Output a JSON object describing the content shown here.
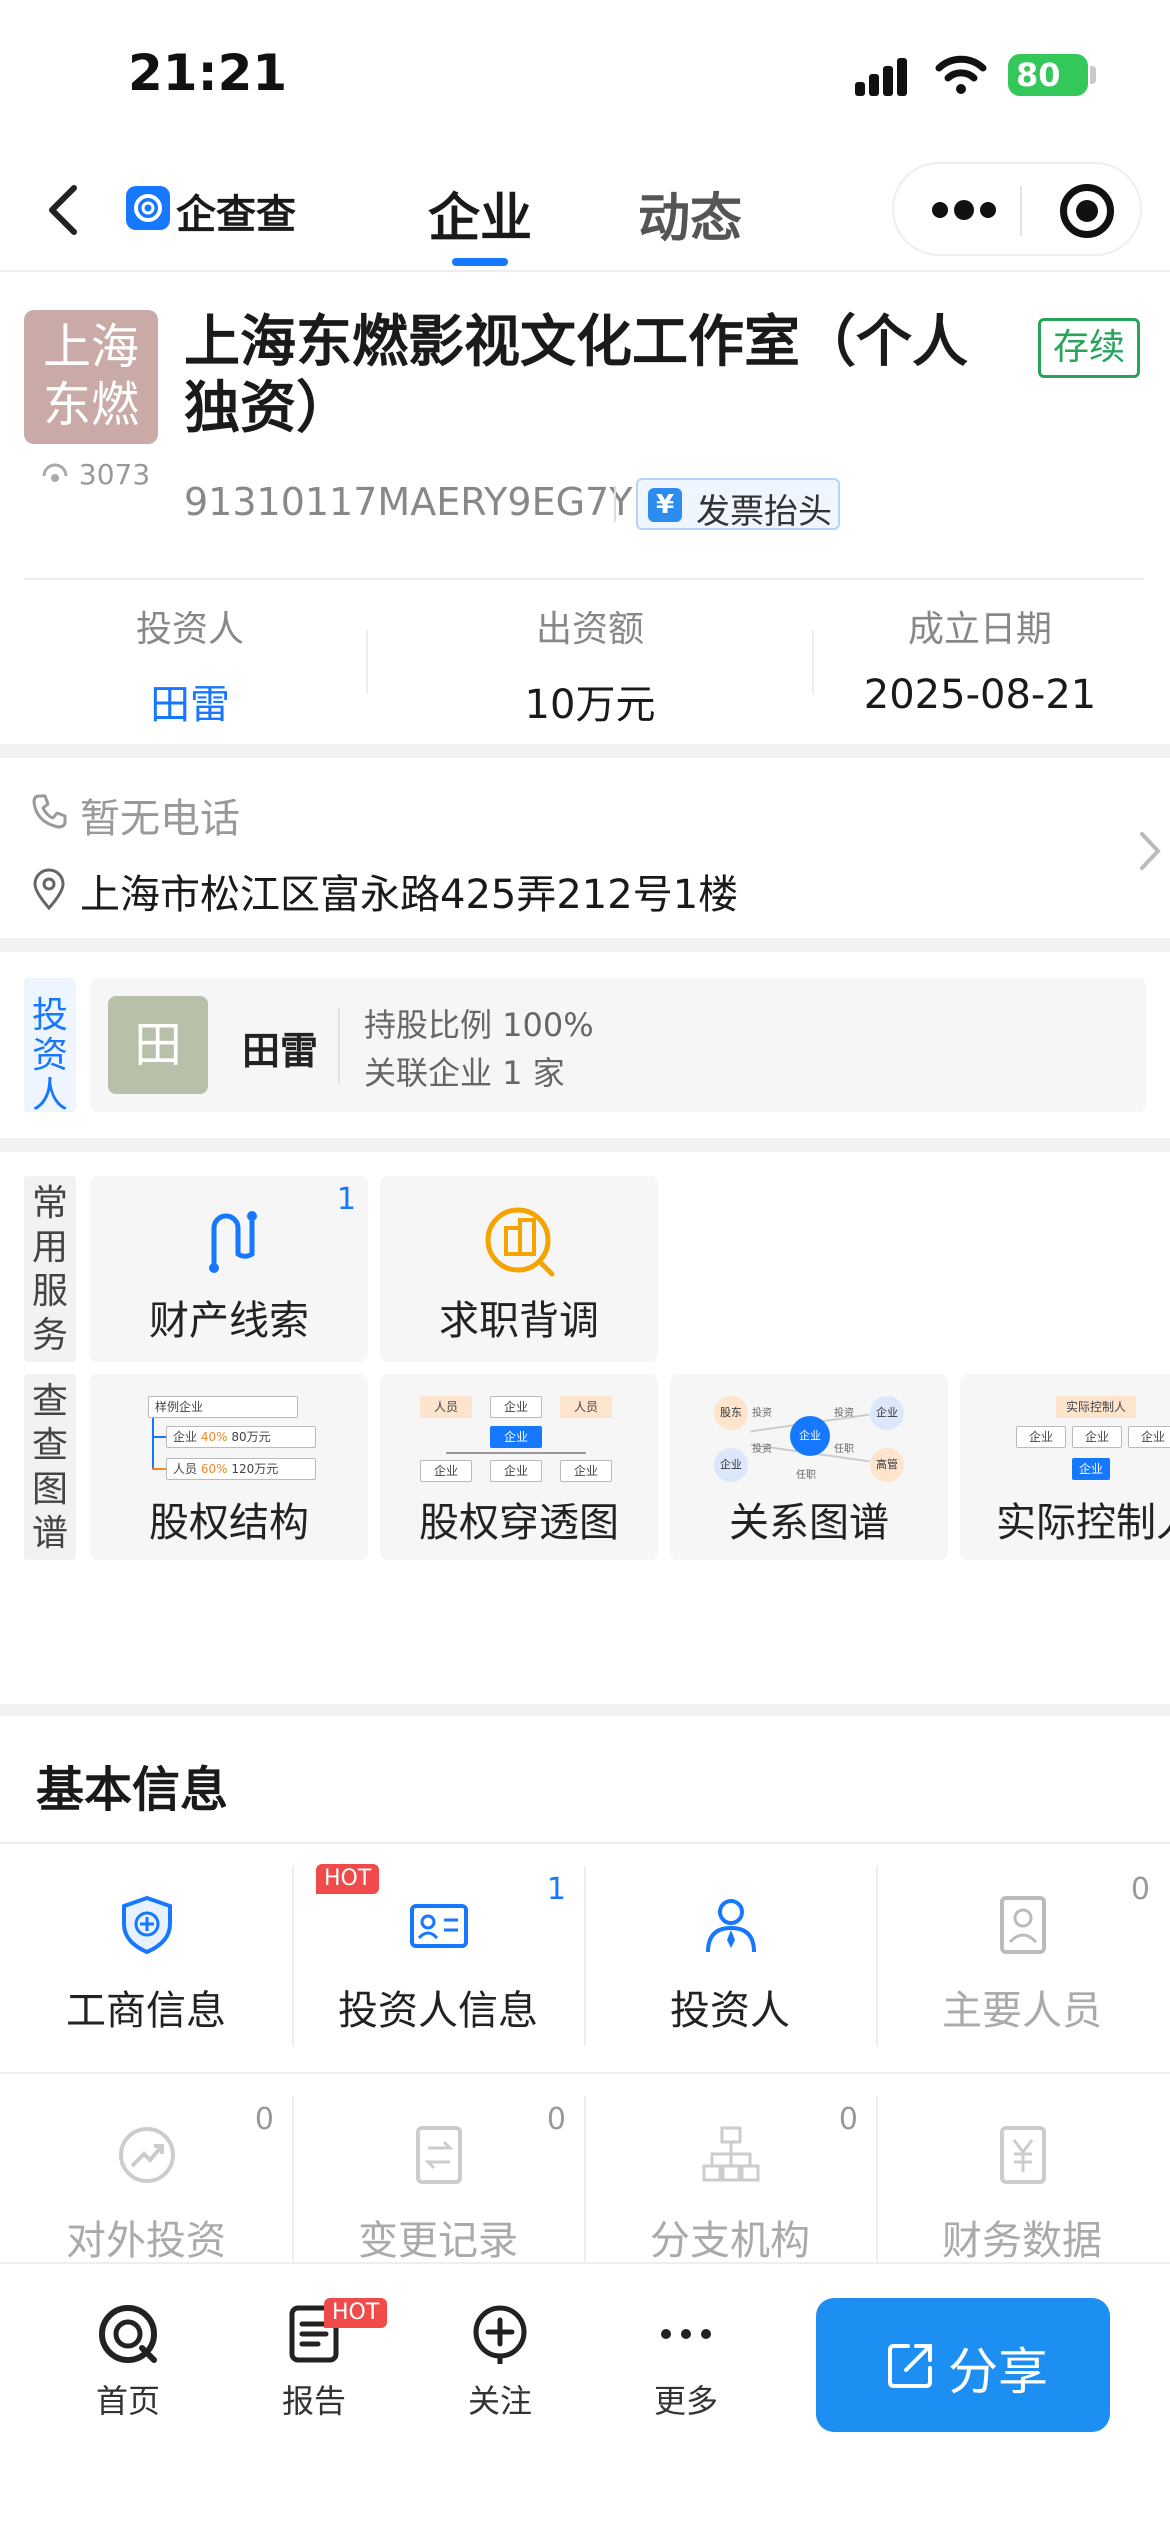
{
  "status_bar": {
    "time": "21:21",
    "battery": "80"
  },
  "nav": {
    "brand": "企查查",
    "tabs": [
      {
        "label": "企业"
      },
      {
        "label": "动态"
      }
    ]
  },
  "company": {
    "logo_text": "上海东燃",
    "views": "3073",
    "name": "上海东燃影视文化工作室（个人独资）",
    "status": "存续",
    "credit_code": "91310117MAERY9EG7Y",
    "invoice_label": "发票抬头",
    "stats": [
      {
        "label": "投资人",
        "value": "田雷"
      },
      {
        "label": "出资额",
        "value": "10万元"
      },
      {
        "label": "成立日期",
        "value": "2025-08-21"
      }
    ]
  },
  "contact": {
    "phone": "暂无电话",
    "address": "上海市松江区富永路425弄212号1楼"
  },
  "investor": {
    "tag": "投资人",
    "avatar_text": "田",
    "name": "田雷",
    "share_ratio": "持股比例 100%",
    "related": "关联企业 1 家"
  },
  "services": {
    "tag": "常用服务",
    "items": [
      {
        "label": "财产线索",
        "count": "1"
      },
      {
        "label": "求职背调",
        "count": ""
      }
    ]
  },
  "graphs": {
    "tag": "查查图谱",
    "items": [
      {
        "label": "股权结构"
      },
      {
        "label": "股权穿透图"
      },
      {
        "label": "关系图谱"
      },
      {
        "label": "实际控制人"
      }
    ],
    "equity_preview": {
      "root": "样例企业",
      "row1": "企业",
      "row1_pct": "40%",
      "row1_amt": "80万元",
      "row2": "人员",
      "row2_pct": "60%",
      "row2_amt": "120万元"
    },
    "penetration_preview": {
      "top": [
        "人员",
        "企业",
        "人员"
      ],
      "center": "企业",
      "bottom": [
        "企业",
        "企业",
        "企业"
      ]
    },
    "relation_preview": {
      "nodes": [
        "股东",
        "企业",
        "企业",
        "企业",
        "高管"
      ],
      "edges": [
        "投资",
        "投资",
        "投资",
        "任职",
        "任职"
      ]
    },
    "controller_preview": {
      "top": "实际控制人",
      "row": [
        "企业",
        "企业",
        "企业"
      ],
      "bottom": "企业"
    }
  },
  "basic_info": {
    "title": "基本信息",
    "hot_label": "HOT",
    "items": [
      {
        "label": "工商信息",
        "count": ""
      },
      {
        "label": "投资人信息",
        "count": "1"
      },
      {
        "label": "投资人",
        "count": ""
      },
      {
        "label": "主要人员",
        "count": "0"
      },
      {
        "label": "对外投资",
        "count": "0"
      },
      {
        "label": "变更记录",
        "count": "0"
      },
      {
        "label": "分支机构",
        "count": "0"
      },
      {
        "label": "财务数据",
        "count": ""
      }
    ]
  },
  "bottom_bar": {
    "items": [
      {
        "label": "首页"
      },
      {
        "label": "报告"
      },
      {
        "label": "关注"
      },
      {
        "label": "更多"
      }
    ],
    "hot_label": "HOT",
    "share_label": "分享"
  },
  "colors": {
    "accent": "#1677ff",
    "status_green": "#27a35a",
    "hot_red": "#f04a4a",
    "share_blue": "#1d8ff2"
  }
}
